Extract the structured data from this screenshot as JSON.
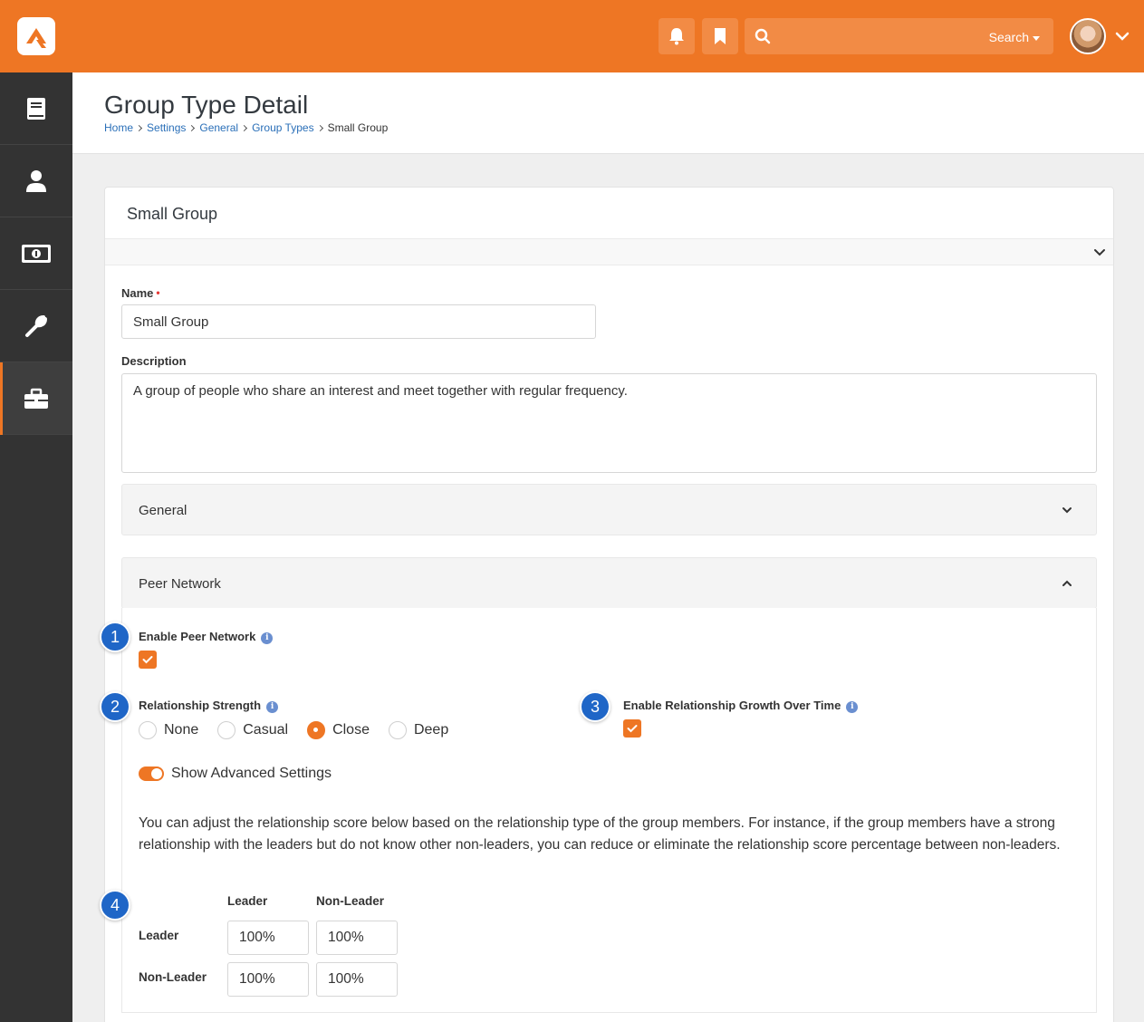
{
  "topbar": {
    "search_label": "Search",
    "icons": [
      "notification-bell-icon",
      "bookmark-icon",
      "search-icon",
      "chevron-down-icon"
    ],
    "accent_color": "#ee7624"
  },
  "sidebar": {
    "items": [
      {
        "icon": "book-icon"
      },
      {
        "icon": "person-icon"
      },
      {
        "icon": "money-icon"
      },
      {
        "icon": "wrench-icon"
      },
      {
        "icon": "briefcase-icon",
        "active": true
      }
    ]
  },
  "page": {
    "title": "Group Type Detail",
    "breadcrumb": [
      "Home",
      "Settings",
      "General",
      "Group Types",
      "Small Group"
    ]
  },
  "panel": {
    "title": "Small Group",
    "name_label": "Name",
    "name_value": "Small Group",
    "description_label": "Description",
    "description_value": "A group of people who share an interest and meet together with regular frequency.",
    "general_section": "General",
    "peer_section": "Peer Network"
  },
  "peer": {
    "badge1": "1",
    "badge2": "2",
    "badge3": "3",
    "badge4": "4",
    "enable_label": "Enable Peer Network",
    "enable_checked": true,
    "strength_label": "Relationship Strength",
    "strength_options": [
      "None",
      "Casual",
      "Close",
      "Deep"
    ],
    "strength_selected": "Close",
    "growth_label": "Enable Relationship Growth Over Time",
    "growth_checked": true,
    "advanced_label": "Show Advanced Settings",
    "advanced_on": true,
    "description": "You can adjust the relationship score below based on the relationship type of the group members. For instance, if the group members have a strong relationship with the leaders but do not know other non-leaders, you can reduce or eliminate the relationship score percentage between non-leaders.",
    "grid": {
      "col_leader": "Leader",
      "col_nonleader": "Non-Leader",
      "row_leader": "Leader",
      "row_nonleader": "Non-Leader",
      "leader_leader": "100%",
      "leader_nonleader": "100%",
      "nonleader_leader": "100%",
      "nonleader_nonleader": "100%"
    }
  }
}
